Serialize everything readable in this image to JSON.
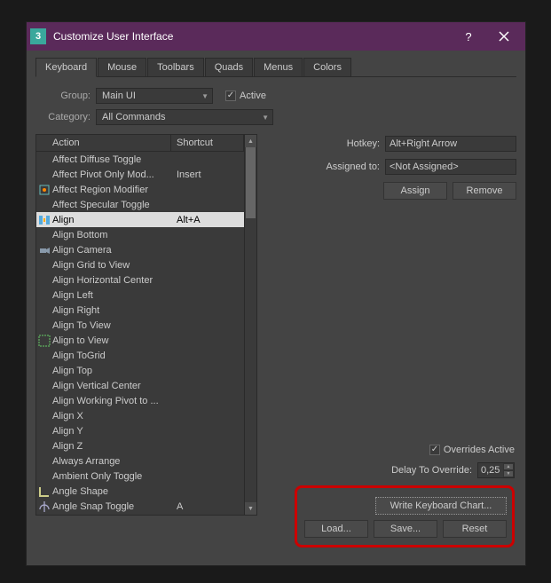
{
  "window": {
    "title": "Customize User Interface"
  },
  "tabs": [
    "Keyboard",
    "Mouse",
    "Toolbars",
    "Quads",
    "Menus",
    "Colors"
  ],
  "activeTab": 0,
  "group": {
    "label": "Group:",
    "value": "Main UI"
  },
  "active": {
    "label": "Active",
    "checked": true
  },
  "category": {
    "label": "Category:",
    "value": "All Commands"
  },
  "table": {
    "headers": {
      "action": "Action",
      "shortcut": "Shortcut"
    },
    "rows": [
      {
        "action": "Affect Diffuse Toggle",
        "shortcut": "",
        "icon": ""
      },
      {
        "action": "Affect Pivot Only Mod...",
        "shortcut": "Insert",
        "icon": ""
      },
      {
        "action": "Affect Region Modifier",
        "shortcut": "",
        "icon": "region"
      },
      {
        "action": "Affect Specular Toggle",
        "shortcut": "",
        "icon": ""
      },
      {
        "action": "Align",
        "shortcut": "Alt+A",
        "icon": "align",
        "selected": true
      },
      {
        "action": "Align Bottom",
        "shortcut": "",
        "icon": ""
      },
      {
        "action": "Align Camera",
        "shortcut": "",
        "icon": "camera"
      },
      {
        "action": "Align Grid to View",
        "shortcut": "",
        "icon": ""
      },
      {
        "action": "Align Horizontal Center",
        "shortcut": "",
        "icon": ""
      },
      {
        "action": "Align Left",
        "shortcut": "",
        "icon": ""
      },
      {
        "action": "Align Right",
        "shortcut": "",
        "icon": ""
      },
      {
        "action": "Align To View",
        "shortcut": "",
        "icon": ""
      },
      {
        "action": "Align to View",
        "shortcut": "",
        "icon": "alignview"
      },
      {
        "action": "Align ToGrid",
        "shortcut": "",
        "icon": ""
      },
      {
        "action": "Align Top",
        "shortcut": "",
        "icon": ""
      },
      {
        "action": "Align Vertical Center",
        "shortcut": "",
        "icon": ""
      },
      {
        "action": "Align Working Pivot to ...",
        "shortcut": "",
        "icon": ""
      },
      {
        "action": "Align X",
        "shortcut": "",
        "icon": ""
      },
      {
        "action": "Align Y",
        "shortcut": "",
        "icon": ""
      },
      {
        "action": "Align Z",
        "shortcut": "",
        "icon": ""
      },
      {
        "action": "Always Arrange",
        "shortcut": "",
        "icon": ""
      },
      {
        "action": "Ambient Only Toggle",
        "shortcut": "",
        "icon": ""
      },
      {
        "action": "Angle Shape",
        "shortcut": "",
        "icon": "angle"
      },
      {
        "action": "Angle Snap Toggle",
        "shortcut": "A",
        "icon": "snap"
      }
    ]
  },
  "hotkey": {
    "label": "Hotkey:",
    "value": "Alt+Right Arrow"
  },
  "assigned": {
    "label": "Assigned to:",
    "value": "<Not Assigned>"
  },
  "buttons": {
    "assign": "Assign",
    "remove": "Remove",
    "write": "Write Keyboard Chart...",
    "load": "Load...",
    "save": "Save...",
    "reset": "Reset"
  },
  "overrides": {
    "active_label": "Overrides Active",
    "active_checked": true,
    "delay_label": "Delay To Override:",
    "delay_value": "0,25"
  }
}
